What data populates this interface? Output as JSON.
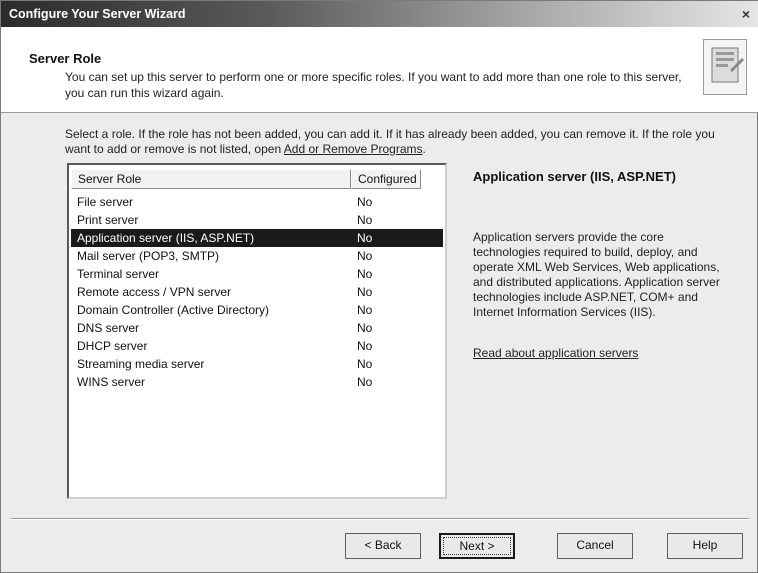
{
  "window": {
    "title": "Configure Your Server Wizard",
    "close_label": "×"
  },
  "header": {
    "title": "Server Role",
    "description": "You can set up this server to perform one or more specific roles. If you want to add more than one role to this server, you can run this wizard again."
  },
  "instruction": {
    "text": "Select a role. If the role has not been added, you can add it. If it has already been added, you can remove it. If the role you want to add or remove is not listed, open ",
    "link": "Add or Remove Programs",
    "suffix": "."
  },
  "table": {
    "columns": [
      "Server Role",
      "Configured"
    ],
    "rows": [
      {
        "role": "File server",
        "configured": "No"
      },
      {
        "role": "Print server",
        "configured": "No"
      },
      {
        "role": "Application server (IIS, ASP.NET)",
        "configured": "No"
      },
      {
        "role": "Mail server (POP3, SMTP)",
        "configured": "No"
      },
      {
        "role": "Terminal server",
        "configured": "No"
      },
      {
        "role": "Remote access / VPN server",
        "configured": "No"
      },
      {
        "role": "Domain Controller (Active Directory)",
        "configured": "No"
      },
      {
        "role": "DNS server",
        "configured": "No"
      },
      {
        "role": "DHCP server",
        "configured": "No"
      },
      {
        "role": "Streaming media server",
        "configured": "No"
      },
      {
        "role": "WINS server",
        "configured": "No"
      }
    ]
  },
  "details": {
    "title": "Application server (IIS, ASP.NET)",
    "description": "Application servers provide the core technologies required to build, deploy, and operate XML Web Services, Web applications, and distributed applications. Application server technologies include ASP.NET, COM+ and Internet Information Services (IIS).",
    "link": "Read about application servers"
  },
  "buttons": {
    "back": "< Back",
    "next": "Next >",
    "cancel": "Cancel",
    "help": "Help"
  }
}
